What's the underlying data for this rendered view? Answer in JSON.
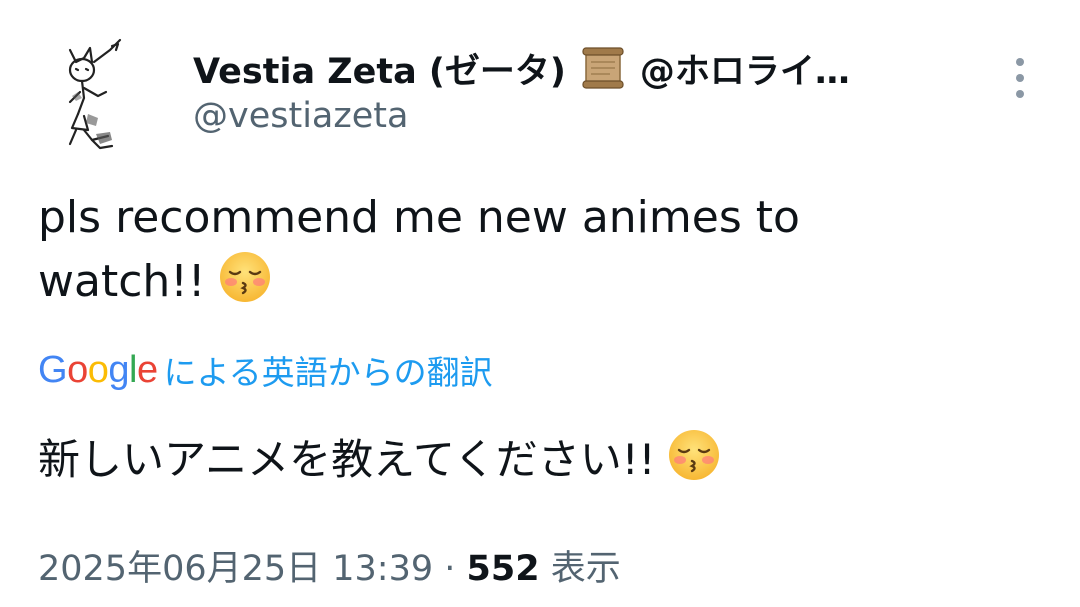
{
  "author": {
    "display_name": "Vestia Zeta (ゼータ)",
    "name_emoji": "scroll-emoji",
    "name_suffix": "@ホロライ…",
    "handle": "@vestiazeta"
  },
  "tweet": {
    "text_line1": "pls recommend me new animes to",
    "text_line2": "watch!!",
    "emoji": "kissing-face-with-closed-eyes"
  },
  "translation": {
    "google_logo": [
      "G",
      "o",
      "o",
      "g",
      "l",
      "e"
    ],
    "label": "による英語からの翻訳",
    "text": "新しいアニメを教えてください!!"
  },
  "meta": {
    "timestamp": "2025年06月25日 13:39",
    "separator": " · ",
    "views_count": "552",
    "views_label": " 表示"
  },
  "colors": {
    "text": "#0f1419",
    "secondary": "#536471",
    "link": "#1d9bf0",
    "google_blue": "#4285f4",
    "google_red": "#ea4335",
    "google_yellow": "#fbbc05",
    "google_green": "#34a853"
  }
}
